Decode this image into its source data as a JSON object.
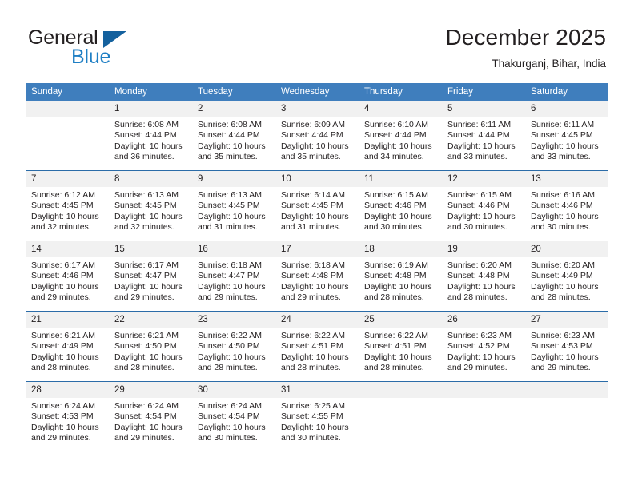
{
  "brand": {
    "name_part1": "General",
    "name_part2": "Blue",
    "triangle_color": "#14619e",
    "blue_color": "#1f7fc4"
  },
  "header": {
    "title": "December 2025",
    "location": "Thakurganj, Bihar, India"
  },
  "theme": {
    "header_bg": "#3f7ebd",
    "header_text": "#ffffff",
    "week_separator": "#2b6ca8",
    "daynum_bg": "#f1f1f1",
    "cell_bg": "#ffffff",
    "text": "#231f20"
  },
  "weekdays": [
    "Sunday",
    "Monday",
    "Tuesday",
    "Wednesday",
    "Thursday",
    "Friday",
    "Saturday"
  ],
  "weeks": [
    {
      "days": [
        {
          "num": "",
          "lines": []
        },
        {
          "num": "1",
          "lines": [
            "Sunrise: 6:08 AM",
            "Sunset: 4:44 PM",
            "Daylight: 10 hours",
            "and 36 minutes."
          ]
        },
        {
          "num": "2",
          "lines": [
            "Sunrise: 6:08 AM",
            "Sunset: 4:44 PM",
            "Daylight: 10 hours",
            "and 35 minutes."
          ]
        },
        {
          "num": "3",
          "lines": [
            "Sunrise: 6:09 AM",
            "Sunset: 4:44 PM",
            "Daylight: 10 hours",
            "and 35 minutes."
          ]
        },
        {
          "num": "4",
          "lines": [
            "Sunrise: 6:10 AM",
            "Sunset: 4:44 PM",
            "Daylight: 10 hours",
            "and 34 minutes."
          ]
        },
        {
          "num": "5",
          "lines": [
            "Sunrise: 6:11 AM",
            "Sunset: 4:44 PM",
            "Daylight: 10 hours",
            "and 33 minutes."
          ]
        },
        {
          "num": "6",
          "lines": [
            "Sunrise: 6:11 AM",
            "Sunset: 4:45 PM",
            "Daylight: 10 hours",
            "and 33 minutes."
          ]
        }
      ]
    },
    {
      "days": [
        {
          "num": "7",
          "lines": [
            "Sunrise: 6:12 AM",
            "Sunset: 4:45 PM",
            "Daylight: 10 hours",
            "and 32 minutes."
          ]
        },
        {
          "num": "8",
          "lines": [
            "Sunrise: 6:13 AM",
            "Sunset: 4:45 PM",
            "Daylight: 10 hours",
            "and 32 minutes."
          ]
        },
        {
          "num": "9",
          "lines": [
            "Sunrise: 6:13 AM",
            "Sunset: 4:45 PM",
            "Daylight: 10 hours",
            "and 31 minutes."
          ]
        },
        {
          "num": "10",
          "lines": [
            "Sunrise: 6:14 AM",
            "Sunset: 4:45 PM",
            "Daylight: 10 hours",
            "and 31 minutes."
          ]
        },
        {
          "num": "11",
          "lines": [
            "Sunrise: 6:15 AM",
            "Sunset: 4:46 PM",
            "Daylight: 10 hours",
            "and 30 minutes."
          ]
        },
        {
          "num": "12",
          "lines": [
            "Sunrise: 6:15 AM",
            "Sunset: 4:46 PM",
            "Daylight: 10 hours",
            "and 30 minutes."
          ]
        },
        {
          "num": "13",
          "lines": [
            "Sunrise: 6:16 AM",
            "Sunset: 4:46 PM",
            "Daylight: 10 hours",
            "and 30 minutes."
          ]
        }
      ]
    },
    {
      "days": [
        {
          "num": "14",
          "lines": [
            "Sunrise: 6:17 AM",
            "Sunset: 4:46 PM",
            "Daylight: 10 hours",
            "and 29 minutes."
          ]
        },
        {
          "num": "15",
          "lines": [
            "Sunrise: 6:17 AM",
            "Sunset: 4:47 PM",
            "Daylight: 10 hours",
            "and 29 minutes."
          ]
        },
        {
          "num": "16",
          "lines": [
            "Sunrise: 6:18 AM",
            "Sunset: 4:47 PM",
            "Daylight: 10 hours",
            "and 29 minutes."
          ]
        },
        {
          "num": "17",
          "lines": [
            "Sunrise: 6:18 AM",
            "Sunset: 4:48 PM",
            "Daylight: 10 hours",
            "and 29 minutes."
          ]
        },
        {
          "num": "18",
          "lines": [
            "Sunrise: 6:19 AM",
            "Sunset: 4:48 PM",
            "Daylight: 10 hours",
            "and 28 minutes."
          ]
        },
        {
          "num": "19",
          "lines": [
            "Sunrise: 6:20 AM",
            "Sunset: 4:48 PM",
            "Daylight: 10 hours",
            "and 28 minutes."
          ]
        },
        {
          "num": "20",
          "lines": [
            "Sunrise: 6:20 AM",
            "Sunset: 4:49 PM",
            "Daylight: 10 hours",
            "and 28 minutes."
          ]
        }
      ]
    },
    {
      "days": [
        {
          "num": "21",
          "lines": [
            "Sunrise: 6:21 AM",
            "Sunset: 4:49 PM",
            "Daylight: 10 hours",
            "and 28 minutes."
          ]
        },
        {
          "num": "22",
          "lines": [
            "Sunrise: 6:21 AM",
            "Sunset: 4:50 PM",
            "Daylight: 10 hours",
            "and 28 minutes."
          ]
        },
        {
          "num": "23",
          "lines": [
            "Sunrise: 6:22 AM",
            "Sunset: 4:50 PM",
            "Daylight: 10 hours",
            "and 28 minutes."
          ]
        },
        {
          "num": "24",
          "lines": [
            "Sunrise: 6:22 AM",
            "Sunset: 4:51 PM",
            "Daylight: 10 hours",
            "and 28 minutes."
          ]
        },
        {
          "num": "25",
          "lines": [
            "Sunrise: 6:22 AM",
            "Sunset: 4:51 PM",
            "Daylight: 10 hours",
            "and 28 minutes."
          ]
        },
        {
          "num": "26",
          "lines": [
            "Sunrise: 6:23 AM",
            "Sunset: 4:52 PM",
            "Daylight: 10 hours",
            "and 29 minutes."
          ]
        },
        {
          "num": "27",
          "lines": [
            "Sunrise: 6:23 AM",
            "Sunset: 4:53 PM",
            "Daylight: 10 hours",
            "and 29 minutes."
          ]
        }
      ]
    },
    {
      "days": [
        {
          "num": "28",
          "lines": [
            "Sunrise: 6:24 AM",
            "Sunset: 4:53 PM",
            "Daylight: 10 hours",
            "and 29 minutes."
          ]
        },
        {
          "num": "29",
          "lines": [
            "Sunrise: 6:24 AM",
            "Sunset: 4:54 PM",
            "Daylight: 10 hours",
            "and 29 minutes."
          ]
        },
        {
          "num": "30",
          "lines": [
            "Sunrise: 6:24 AM",
            "Sunset: 4:54 PM",
            "Daylight: 10 hours",
            "and 30 minutes."
          ]
        },
        {
          "num": "31",
          "lines": [
            "Sunrise: 6:25 AM",
            "Sunset: 4:55 PM",
            "Daylight: 10 hours",
            "and 30 minutes."
          ]
        },
        {
          "num": "",
          "lines": []
        },
        {
          "num": "",
          "lines": []
        },
        {
          "num": "",
          "lines": []
        }
      ]
    }
  ]
}
